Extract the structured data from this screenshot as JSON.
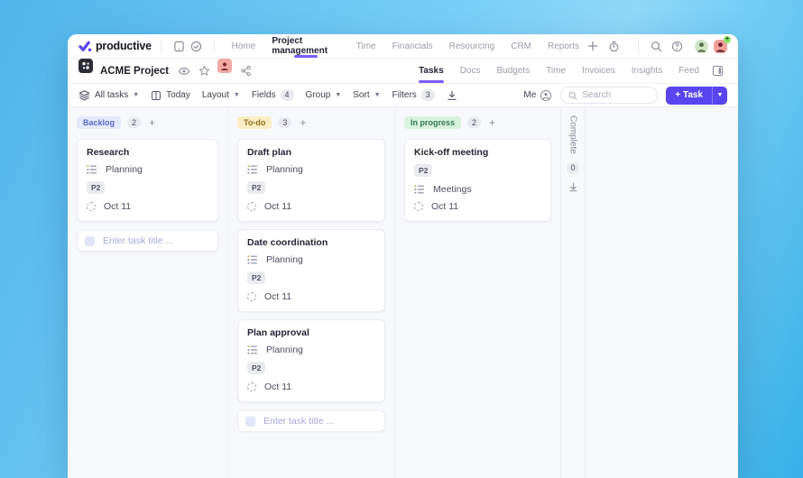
{
  "brand": {
    "name": "productive"
  },
  "topbar": {
    "nav": [
      {
        "label": "Home",
        "active": false
      },
      {
        "label": "Project management",
        "active": true
      },
      {
        "label": "Time",
        "active": false
      },
      {
        "label": "Financials",
        "active": false
      },
      {
        "label": "Resourcing",
        "active": false
      },
      {
        "label": "CRM",
        "active": false
      },
      {
        "label": "Reports",
        "active": false
      }
    ]
  },
  "project": {
    "title": "ACME Project",
    "tabs": [
      {
        "label": "Tasks",
        "active": true
      },
      {
        "label": "Docs",
        "active": false
      },
      {
        "label": "Budgets",
        "active": false
      },
      {
        "label": "Time",
        "active": false
      },
      {
        "label": "Invoices",
        "active": false
      },
      {
        "label": "Insights",
        "active": false
      },
      {
        "label": "Feed",
        "active": false
      }
    ]
  },
  "toolbar": {
    "scope_label": "All tasks",
    "today_label": "Today",
    "layout_label": "Layout",
    "fields_label": "Fields",
    "fields_count": "4",
    "group_label": "Group",
    "sort_label": "Sort",
    "filters_label": "Filters",
    "filters_count": "3",
    "me_label": "Me",
    "search_placeholder": "Search",
    "new_task_label": "+ Task"
  },
  "board": {
    "add_task_placeholder": "Enter task title ...",
    "columns": [
      {
        "label": "Backlog",
        "count": "2",
        "pill_bg": "#e4e9fc",
        "pill_color": "#5a68cf",
        "has_add_input": true,
        "cards": [
          {
            "title": "Research",
            "fields": [
              {
                "type": "list",
                "text": "Planning"
              },
              {
                "type": "priority",
                "text": "P2"
              },
              {
                "type": "date",
                "text": "Oct 11"
              }
            ]
          }
        ]
      },
      {
        "label": "To-do",
        "count": "3",
        "pill_bg": "#fbeec4",
        "pill_color": "#8f6f1c",
        "has_add_input": true,
        "cards": [
          {
            "title": "Draft plan",
            "fields": [
              {
                "type": "list",
                "text": "Planning"
              },
              {
                "type": "priority",
                "text": "P2"
              },
              {
                "type": "date",
                "text": "Oct 11"
              }
            ]
          },
          {
            "title": "Date coordination",
            "fields": [
              {
                "type": "list",
                "text": "Planning"
              },
              {
                "type": "priority",
                "text": "P2"
              },
              {
                "type": "date",
                "text": "Oct 11"
              }
            ]
          },
          {
            "title": "Plan approval",
            "fields": [
              {
                "type": "list",
                "text": "Planning"
              },
              {
                "type": "priority",
                "text": "P2"
              },
              {
                "type": "date",
                "text": "Oct 11"
              }
            ]
          }
        ]
      },
      {
        "label": "In progress",
        "count": "2",
        "pill_bg": "#d7f2df",
        "pill_color": "#33794f",
        "has_add_input": false,
        "cards": [
          {
            "title": "Kick-off meeting",
            "fields": [
              {
                "type": "priority",
                "text": "P2"
              },
              {
                "type": "list",
                "text": "Meetings"
              },
              {
                "type": "date",
                "text": "Oct 11"
              }
            ]
          }
        ]
      }
    ],
    "collapsed_column": {
      "label": "Complete",
      "count": "0"
    }
  }
}
